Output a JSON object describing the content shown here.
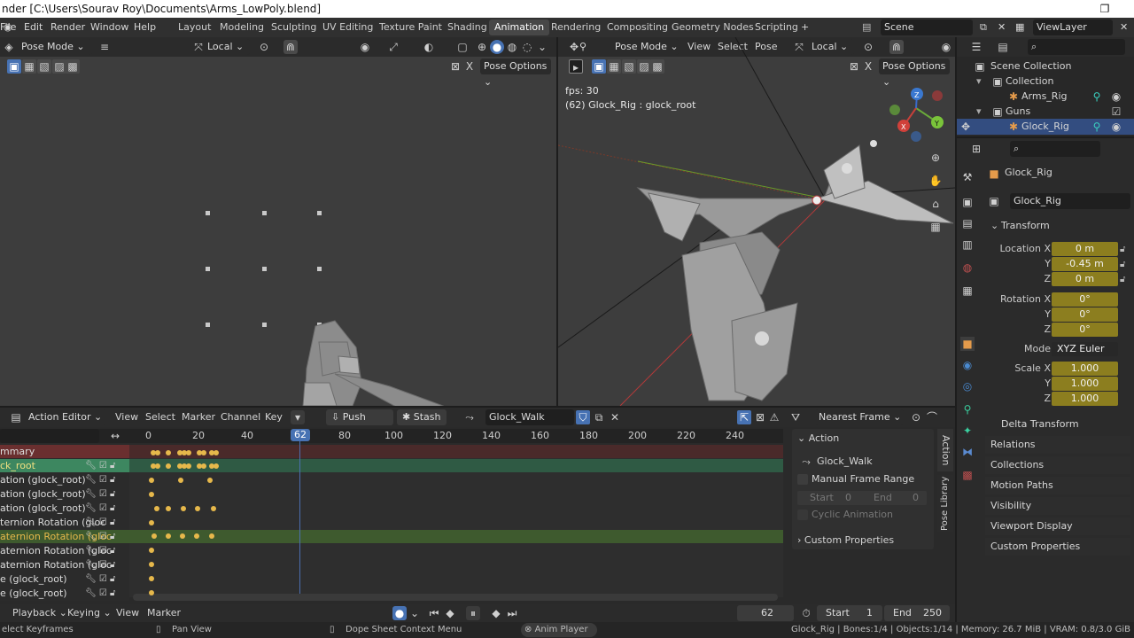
{
  "titlebar": {
    "title": "nder [C:\\Users\\Sourav Roy\\Documents\\Arms_LowPoly.blend]",
    "max_glyph": "❐"
  },
  "menus": [
    "File",
    "Edit",
    "Render",
    "Window",
    "Help"
  ],
  "workspaces": [
    "Layout",
    "Modeling",
    "Sculpting",
    "UV Editing",
    "Texture Paint",
    "Shading",
    "Animation",
    "Rendering",
    "Compositing",
    "Geometry Nodes",
    "Scripting"
  ],
  "active_workspace": "Animation",
  "scene": {
    "name": "Scene",
    "viewlayer": "ViewLayer"
  },
  "left_view": {
    "mode": "Pose Mode",
    "orientation": "Local",
    "pose_options": "Pose Options"
  },
  "right_view": {
    "mode": "Pose Mode",
    "menus": [
      "View",
      "Select",
      "Pose"
    ],
    "orientation": "Local",
    "pose_options": "Pose Options",
    "fps": "fps: 30",
    "info": "(62) Glock_Rig : glock_root"
  },
  "outliner": {
    "root": "Scene Collection",
    "items": [
      {
        "label": "Collection"
      },
      {
        "label": "Arms_Rig"
      },
      {
        "label": "Guns"
      },
      {
        "label": "Glock_Rig"
      }
    ]
  },
  "properties": {
    "object_name": "Glock_Rig",
    "data_name": "Glock_Rig",
    "transform_header": "Transform",
    "location": {
      "label_x": "Location X",
      "label_y": "Y",
      "label_z": "Z",
      "x": "0 m",
      "y": "-0.45 m",
      "z": "0 m"
    },
    "rotation": {
      "label_x": "Rotation X",
      "label_y": "Y",
      "label_z": "Z",
      "x": "0°",
      "y": "0°",
      "z": "0°"
    },
    "mode_label": "Mode",
    "mode": "XYZ Euler",
    "scale": {
      "label_x": "Scale X",
      "label_y": "Y",
      "label_z": "Z",
      "x": "1.000",
      "y": "1.000",
      "z": "1.000"
    },
    "panels": [
      "Delta Transform",
      "Relations",
      "Collections",
      "Motion Paths",
      "Visibility",
      "Viewport Display",
      "Custom Properties"
    ]
  },
  "action_editor": {
    "editor": "Action Editor",
    "menus": [
      "View",
      "Select",
      "Marker",
      "Channel",
      "Key"
    ],
    "push_down": "Push Down",
    "stash": "Stash",
    "action": "Glock_Walk",
    "snap": "Nearest Frame",
    "current_frame": "62",
    "ruler": [
      "0",
      "20",
      "40",
      "62",
      "80",
      "100",
      "120",
      "140",
      "160",
      "180",
      "200",
      "220",
      "240"
    ],
    "channels": [
      "mmary",
      "ck_root",
      "ation (glock_root)",
      "ation (glock_root)",
      "ation (glock_root)",
      "ternion Rotation (gloc",
      "aternion Rotation (gloc",
      "aternion Rotation (gloc",
      "aternion Rotation (gloc",
      "e (glock_root)",
      "e (glock_root)"
    ]
  },
  "action_panel": {
    "header": "Action",
    "action_name": "Glock_Walk",
    "manual_range": "Manual Frame Range",
    "start_label": "Start",
    "start": "0",
    "end_label": "End",
    "end": "0",
    "cyclic": "Cyclic Animation",
    "custom": "Custom Properties",
    "tab_action": "Action",
    "tab_pose_library": "Pose Library"
  },
  "timeline": {
    "menus": [
      "Playback",
      "Keying",
      "View",
      "Marker"
    ],
    "frame": "62",
    "start_label": "Start",
    "start": "1",
    "end_label": "End",
    "end": "250"
  },
  "statusbar": {
    "left": "elect Keyframes",
    "pan": "Pan View",
    "context": "Dope Sheet Context Menu",
    "anim": "Anim Player",
    "right": "Glock_Rig | Bones:1/4 | Objects:1/14 | Memory: 26.7 MiB | VRAM: 0.8/3.0 GiB"
  },
  "colors": {
    "accent": "#4772b3",
    "keyframe": "#e6b84b",
    "selected_channel": "#3d8760",
    "playhead": "#4c6fb0"
  }
}
